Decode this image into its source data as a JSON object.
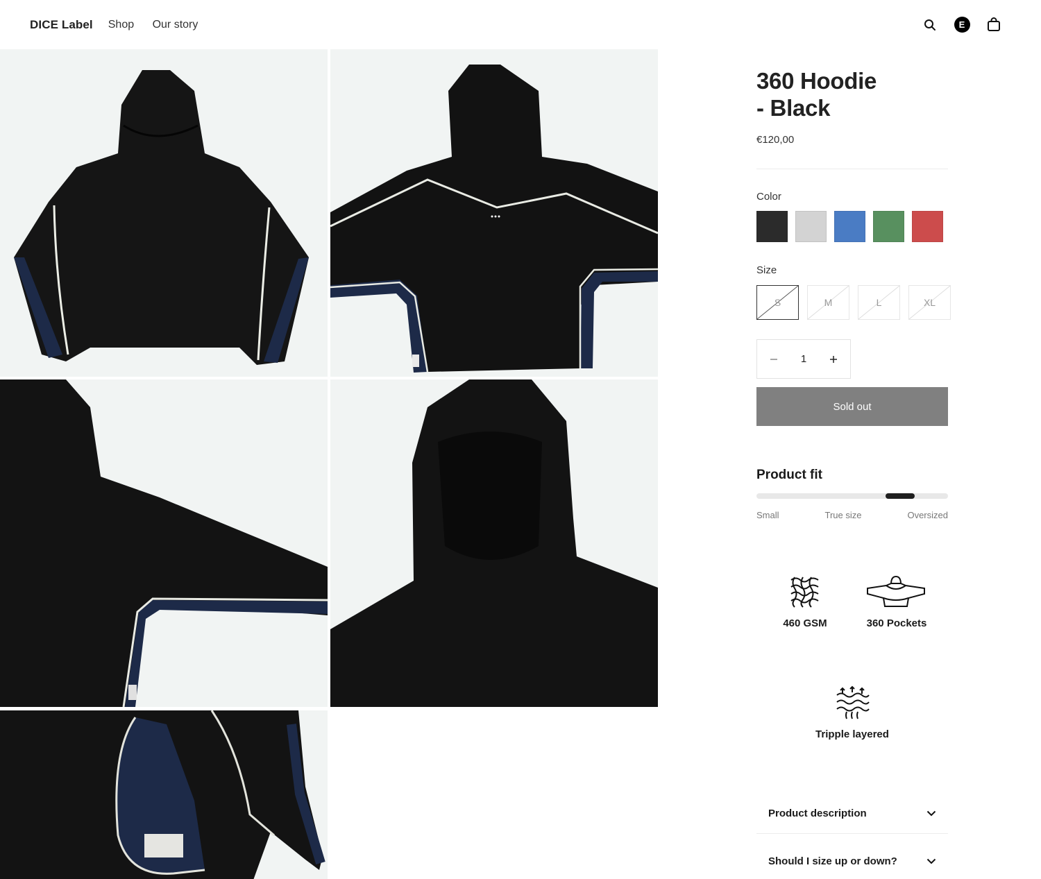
{
  "header": {
    "brand": "DICE Label",
    "nav": [
      "Shop",
      "Our story"
    ],
    "account_initial": "E"
  },
  "product": {
    "title_line1": "360 Hoodie",
    "title_line2": "- Black",
    "price": "€120,00",
    "color_label": "Color",
    "colors": [
      "#2b2b2b",
      "#d3d3d3",
      "#4a7cc4",
      "#58905f",
      "#cc4c4c"
    ],
    "size_label": "Size",
    "sizes": [
      "S",
      "M",
      "L",
      "XL"
    ],
    "selected_size": "S",
    "quantity": "1",
    "button_label": "Sold out",
    "fit": {
      "title": "Product fit",
      "labels": [
        "Small",
        "True size",
        "Oversized"
      ],
      "level": 0.75
    },
    "features": [
      "460 GSM",
      "360 Pockets",
      "Tripple layered"
    ],
    "accordions": [
      "Product description",
      "Should I size up or down?"
    ]
  },
  "gallery": {
    "image_count": 5
  }
}
